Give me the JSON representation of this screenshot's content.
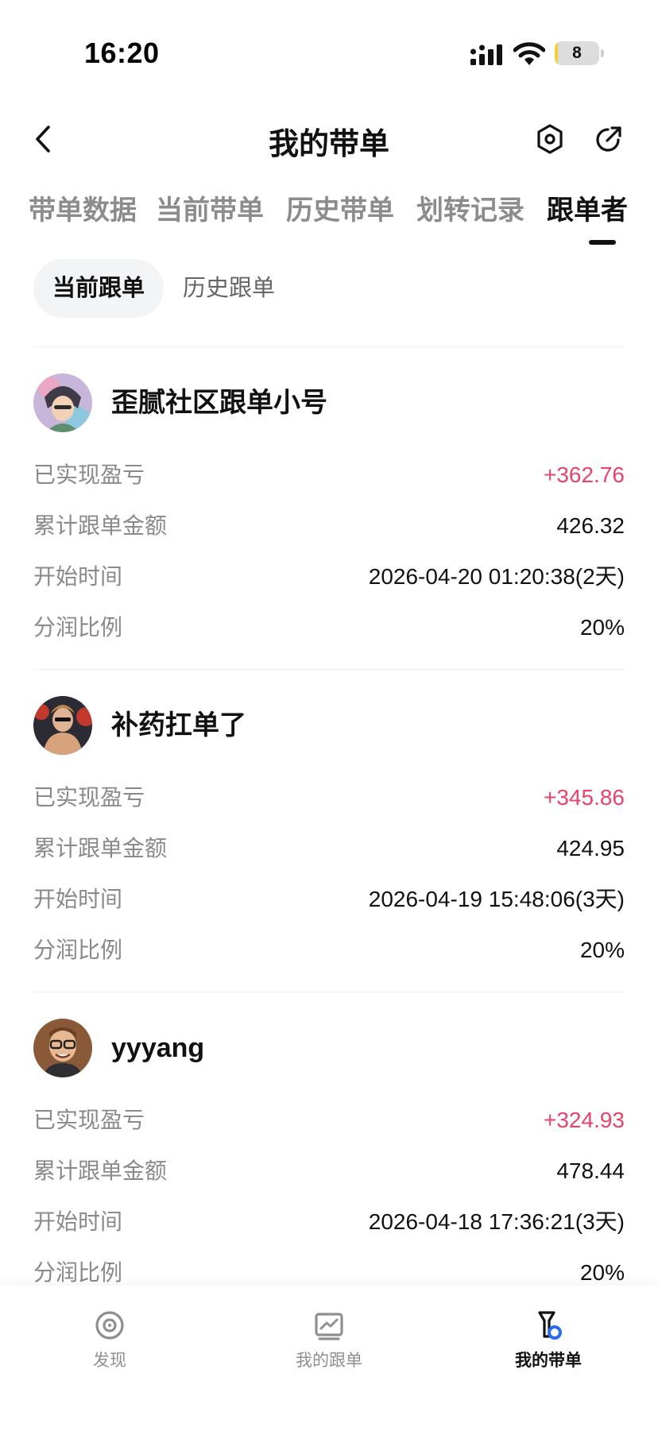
{
  "status_bar": {
    "time": "16:20",
    "battery_level": "8",
    "battery_fraction": 0.08
  },
  "nav": {
    "title": "我的带单"
  },
  "main_tabs": [
    "带单数据",
    "当前带单",
    "历史带单",
    "划转记录",
    "跟单者"
  ],
  "main_tabs_active": "跟单者",
  "sub_tabs": [
    "当前跟单",
    "历史跟单"
  ],
  "sub_tabs_active": "当前跟单",
  "followers": [
    {
      "name": "歪腻社区跟单小号",
      "avatar": "anime-character-avatar",
      "realized_pnl_label": "已实现盈亏",
      "realized_pnl": "+362.76",
      "total_amount_label": "累计跟单金额",
      "total_amount": "426.32",
      "start_time_label": "开始时间",
      "start_time": "2026-04-20 01:20:38(2天)",
      "profit_share_label": "分润比例",
      "profit_share": "20%"
    },
    {
      "name": "补药扛单了",
      "avatar": "person-photo-avatar",
      "realized_pnl_label": "已实现盈亏",
      "realized_pnl": "+345.86",
      "total_amount_label": "累计跟单金额",
      "total_amount": "424.95",
      "start_time_label": "开始时间",
      "start_time": "2026-04-19 15:48:06(3天)",
      "profit_share_label": "分润比例",
      "profit_share": "20%"
    },
    {
      "name": "yyyang",
      "avatar": "person-with-glasses-avatar",
      "realized_pnl_label": "已实现盈亏",
      "realized_pnl": "+324.93",
      "total_amount_label": "累计跟单金额",
      "total_amount": "478.44",
      "start_time_label": "开始时间",
      "start_time": "2026-04-18 17:36:21(3天)",
      "profit_share_label": "分润比例",
      "profit_share": "20%"
    }
  ],
  "bottom_nav": [
    {
      "label": "发现",
      "icon": "discover-icon"
    },
    {
      "label": "我的跟单",
      "icon": "chart-icon"
    },
    {
      "label": "我的带单",
      "icon": "lead-trade-icon"
    }
  ],
  "bottom_nav_active": "我的带单",
  "colors": {
    "profit": "#e8436a",
    "text": "#111111",
    "muted": "#8a8a8a",
    "accent": "#2a6de8"
  }
}
